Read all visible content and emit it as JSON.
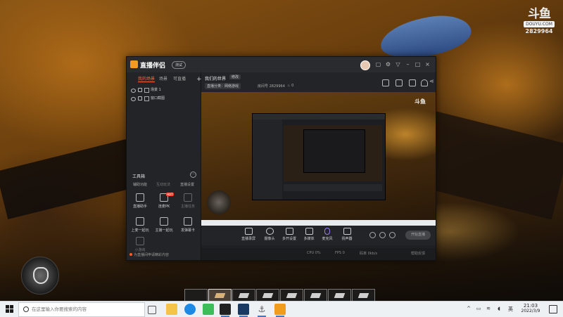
{
  "watermark": {
    "logo_text": "斗鱼",
    "sub_label": "DOUYU.COM",
    "room_id": "2829964"
  },
  "app": {
    "name": "直播伴侣",
    "version_badge": "测试",
    "sidebar": {
      "tabs": [
        "我的场景",
        "场景",
        "可直播"
      ],
      "scenes": [
        {
          "label": "场景 1"
        },
        {
          "label": "窗口截图"
        }
      ],
      "tools_title": "工具箱",
      "tool_tabs": [
        "辅助功能",
        "互动玩法",
        "直播设置"
      ],
      "tools": [
        {
          "label": "直播助手",
          "icon": "assistant-icon",
          "badge": ""
        },
        {
          "label": "连麦PK",
          "icon": "pk-icon",
          "badge": "HOT"
        },
        {
          "label": "主播任务",
          "icon": "task-icon",
          "badge": ""
        },
        {
          "label": "上麦一起玩",
          "icon": "gamepad-icon",
          "badge": ""
        },
        {
          "label": "主播一起玩",
          "icon": "play-together-icon",
          "badge": ""
        },
        {
          "label": "发弹幕卡",
          "icon": "danmaku-card-icon",
          "badge": ""
        },
        {
          "label": "小游戏",
          "icon": "minigame-icon",
          "badge": ""
        }
      ],
      "notice": "为直播间申请精彩内容"
    },
    "header": {
      "room_title": "我们的世界",
      "edit_label": "修改",
      "category": "直播分类：网络游戏",
      "room_label": "房间号",
      "room_id": "2829964",
      "hot_count": "0"
    },
    "preview_logo": "斗鱼",
    "controls": [
      {
        "label": "直播录屏",
        "icon": "screen-record-icon"
      },
      {
        "label": "摄像头",
        "icon": "camera-icon"
      },
      {
        "label": "多开设置",
        "icon": "multi-icon"
      },
      {
        "label": "多媒体",
        "icon": "media-icon"
      },
      {
        "label": "麦克风",
        "icon": "microphone-icon"
      },
      {
        "label": "扬声器",
        "icon": "speaker-icon"
      }
    ],
    "start_label": "开始直播",
    "status": {
      "cpu": "CPU 0%",
      "fps": "FPS 0",
      "bitrate": "码率 0kb/s",
      "feedback": "帮助反馈"
    }
  },
  "taskbar": {
    "search_placeholder": "在这里输入你要搜索的内容",
    "language": "英",
    "time": "21:03",
    "date": "2022/3/9"
  }
}
